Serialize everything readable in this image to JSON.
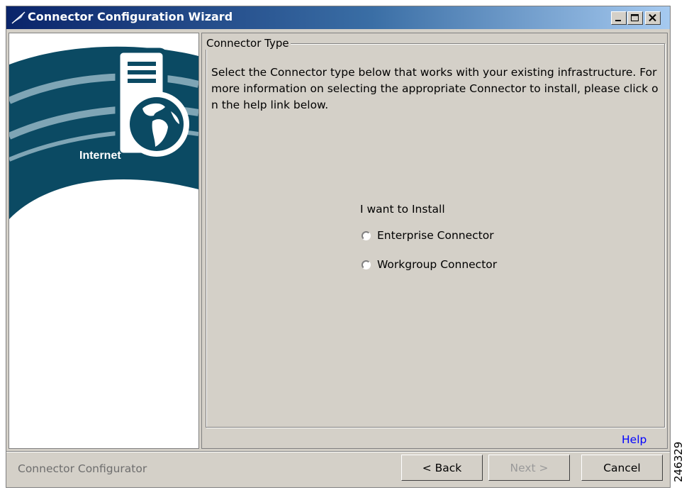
{
  "window": {
    "title": "Connector Configuration Wizard"
  },
  "sidebar": {
    "graphic_label": "Internet"
  },
  "main": {
    "group_label": "Connector Type",
    "description": "Select the Connector type below that works with your existing infrastructure. For more information on selecting the appropriate Connector to install, please click on the help link below.",
    "install_prompt": "I want to Install",
    "options": [
      {
        "label": "Enterprise Connector",
        "selected": false
      },
      {
        "label": "Workgroup Connector",
        "selected": false
      }
    ],
    "help_link": "Help"
  },
  "footer": {
    "status": "Connector Configurator",
    "back_label": "< Back",
    "next_label": "Next >",
    "cancel_label": "Cancel"
  },
  "figure_id": "246329",
  "colors": {
    "title_bar_start": "#0a246a",
    "title_bar_end": "#a6caf0",
    "banner": "#0b4a63",
    "link": "#0000ff",
    "disabled_text": "#9a9a9a"
  }
}
